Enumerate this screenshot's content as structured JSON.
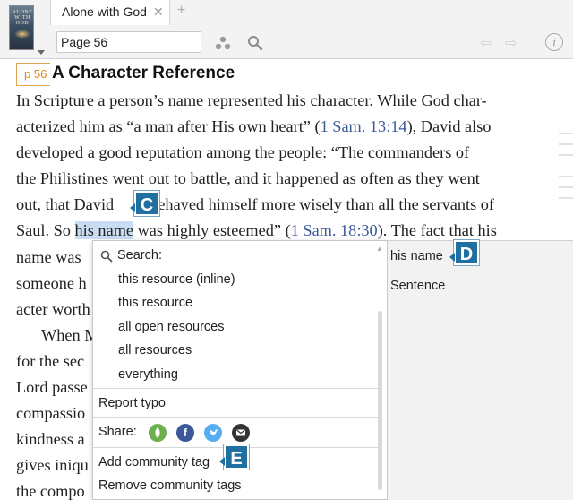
{
  "tab": {
    "title": "Alone with God",
    "close": "✕",
    "add": "+"
  },
  "thumbnail": {
    "cover_text": "ALONE WITH GOD"
  },
  "toolbar": {
    "page_value": "Page 56",
    "back": "⇦",
    "forward": "⇨",
    "info": "i"
  },
  "document": {
    "page_marker": "p 56",
    "heading": "A Character Reference",
    "lines": [
      [
        "In Scripture a person’s name represented his character. While God char-"
      ],
      [
        "acterized him as “a man after His own heart” (",
        "1 Sam. 13:14",
        "), David also"
      ],
      [
        "developed a good reputation among the people: “The commanders of"
      ],
      [
        "the Philistines went out to battle, and it happened as often as they went"
      ],
      [
        "out, that David",
        "behaved himself more wisely than all the servants of"
      ],
      [
        "Saul. So ",
        "his name",
        " was highly esteemed” (",
        "1 Sam. 18:30",
        "). The fact that his"
      ],
      [
        "name was"
      ],
      [
        "someone h"
      ],
      [
        "acter worth"
      ],
      [
        "When M"
      ],
      [
        "for the sec"
      ],
      [
        "Lord passe"
      ],
      [
        "compassio"
      ],
      [
        "kindness a"
      ],
      [
        "gives iniqu"
      ],
      [
        "the compo"
      ]
    ]
  },
  "callouts": {
    "c": "C",
    "d": "D",
    "e": "E"
  },
  "context_menu": {
    "search_label": "Search:",
    "search_options": [
      "this resource (inline)",
      "this resource",
      "all open resources",
      "all resources",
      "everything"
    ],
    "report_typo": "Report typo",
    "share_label": "Share:",
    "share_icons": [
      "logos-icon",
      "facebook-icon",
      "twitter-icon",
      "email-icon"
    ],
    "add_tag": "Add community tag",
    "remove_tag": "Remove community tags"
  },
  "right_panel": {
    "items": [
      "his name",
      "Sentence"
    ]
  },
  "colors": {
    "link": "#3a5a9a",
    "highlight": "#c9dcf2",
    "callout": "#1f6fa0",
    "page_marker": "#e08a20"
  }
}
